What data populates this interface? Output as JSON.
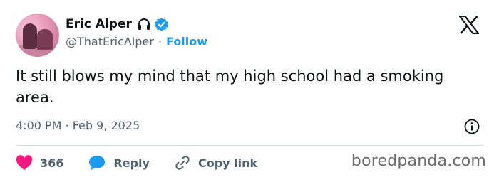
{
  "author": {
    "name": "Eric Alper",
    "handle": "@ThatEricAlper",
    "separator": "·",
    "follow_label": "Follow",
    "name_emoji_icon": "headphones-icon",
    "verified_icon": "verified-badge-icon",
    "verified_color": "#1d9bf0"
  },
  "tweet": {
    "text": "It still blows my mind that my high school had a smoking area.",
    "timestamp": "4:00 PM · Feb 9, 2025"
  },
  "actions": {
    "like_count": "366",
    "like_color": "#f91880",
    "reply_label": "Reply",
    "reply_color": "#1d9bf0",
    "copy_label": "Copy link"
  },
  "watermark": "boredpanda.com",
  "accent": "#1d9bf0"
}
